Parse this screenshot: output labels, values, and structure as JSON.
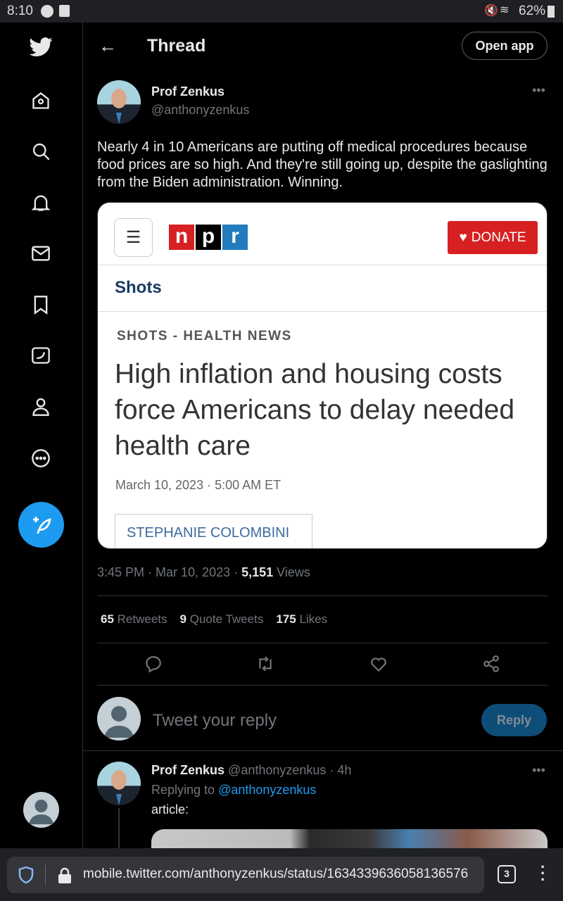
{
  "status_bar": {
    "time": "8:10",
    "battery": "62%"
  },
  "header": {
    "title": "Thread",
    "open_app": "Open app"
  },
  "tweet": {
    "name": "Prof Zenkus",
    "handle": "@anthonyzenkus",
    "text": "Nearly 4 in 10 Americans are putting off medical procedures because food prices are so high. And they're still going up, despite the gaslighting from the Biden administration. Winning.",
    "card": {
      "logo": [
        "n",
        "p",
        "r"
      ],
      "donate": "DONATE",
      "section": "Shots",
      "kicker": "SHOTS - HEALTH NEWS",
      "headline": "High inflation and housing costs force Americans to delay needed health care",
      "date": "March 10, 2023 · 5:00 AM ET",
      "author": "STEPHANIE COLOMBINI"
    },
    "time": "3:45 PM · Mar 10, 2023 · ",
    "views_count": "5,151",
    "views_label": " Views",
    "stats": {
      "retweets": "65",
      "retweets_label": "Retweets",
      "quotes": "9",
      "quotes_label": "Quote Tweets",
      "likes": "175",
      "likes_label": "Likes"
    }
  },
  "reply_box": {
    "placeholder": "Tweet your reply",
    "button": "Reply"
  },
  "reply": {
    "name": "Prof Zenkus",
    "handle": "@anthonyzenkus · 4h",
    "replying_to": "Replying to ",
    "replying_handle": "@anthonyzenkus",
    "text": "article:"
  },
  "browser": {
    "url": "mobile.twitter.com/anthonyzenkus/status/1634339636058136576",
    "tabs": "3"
  },
  "colors": {
    "accent": "#1d9bf0",
    "npr_red": "#d62021",
    "npr_blue": "#237bbd"
  }
}
